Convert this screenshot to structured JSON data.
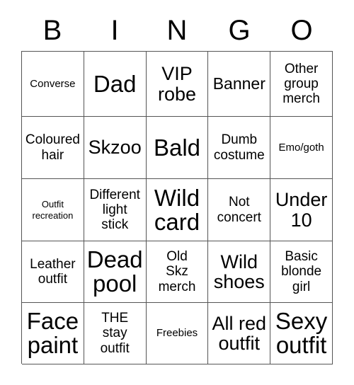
{
  "header": {
    "letters": [
      "B",
      "I",
      "N",
      "G",
      "O"
    ]
  },
  "grid": {
    "rows": [
      [
        {
          "text": "Converse",
          "size": "fs-sm"
        },
        {
          "text": "Dad",
          "size": "fs-xxl"
        },
        {
          "text": "VIP\nrobe",
          "size": "fs-xl"
        },
        {
          "text": "Banner",
          "size": "fs-lg"
        },
        {
          "text": "Other\ngroup\nmerch",
          "size": "fs-md"
        }
      ],
      [
        {
          "text": "Coloured\nhair",
          "size": "fs-md"
        },
        {
          "text": "Skzoo",
          "size": "fs-xl"
        },
        {
          "text": "Bald",
          "size": "fs-xxl"
        },
        {
          "text": "Dumb\ncostume",
          "size": "fs-md"
        },
        {
          "text": "Emo/goth",
          "size": "fs-sm"
        }
      ],
      [
        {
          "text": "Outfit\nrecreation",
          "size": "fs-xs"
        },
        {
          "text": "Different\nlight\nstick",
          "size": "fs-md"
        },
        {
          "text": "Wild\ncard",
          "size": "fs-xxl"
        },
        {
          "text": "Not\nconcert",
          "size": "fs-md"
        },
        {
          "text": "Under\n10",
          "size": "fs-xl"
        }
      ],
      [
        {
          "text": "Leather\noutfit",
          "size": "fs-md"
        },
        {
          "text": "Dead\npool",
          "size": "fs-xxl"
        },
        {
          "text": "Old\nSkz\nmerch",
          "size": "fs-md"
        },
        {
          "text": "Wild\nshoes",
          "size": "fs-xl"
        },
        {
          "text": "Basic\nblonde\ngirl",
          "size": "fs-md"
        }
      ],
      [
        {
          "text": "Face\npaint",
          "size": "fs-xxl"
        },
        {
          "text": "THE\nstay\noutfit",
          "size": "fs-md"
        },
        {
          "text": "Freebies",
          "size": "fs-sm"
        },
        {
          "text": "All red\noutfit",
          "size": "fs-xl"
        },
        {
          "text": "Sexy\noutfit",
          "size": "fs-xxl"
        }
      ]
    ]
  },
  "colors": {
    "background": "#ffffff",
    "text": "#000000",
    "grid_line": "#555555"
  }
}
